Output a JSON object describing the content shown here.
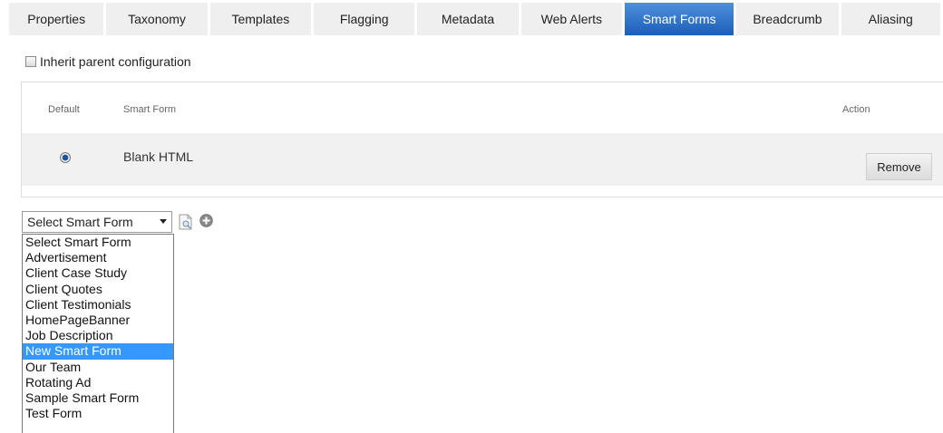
{
  "tabs": [
    {
      "label": "Properties",
      "active": false
    },
    {
      "label": "Taxonomy",
      "active": false
    },
    {
      "label": "Templates",
      "active": false
    },
    {
      "label": "Flagging",
      "active": false
    },
    {
      "label": "Metadata",
      "active": false
    },
    {
      "label": "Web Alerts",
      "active": false
    },
    {
      "label": "Smart Forms",
      "active": true
    },
    {
      "label": "Breadcrumb",
      "active": false
    },
    {
      "label": "Aliasing",
      "active": false
    }
  ],
  "inherit": {
    "label": "Inherit parent configuration",
    "checked": false
  },
  "table": {
    "headers": {
      "default": "Default",
      "smart_form": "Smart Form",
      "action": "Action"
    },
    "rows": [
      {
        "selected": true,
        "name": "Blank HTML",
        "action_label": "Remove"
      }
    ]
  },
  "select": {
    "value": "Select Smart Form",
    "options": [
      "Select Smart Form",
      "Advertisement",
      "Client Case Study",
      "Client Quotes",
      "Client Testimonials",
      "HomePageBanner",
      "Job Description",
      "New Smart Form",
      "Our Team",
      "Rotating Ad",
      "Sample Smart Form",
      "Test Form"
    ],
    "highlighted": "New Smart Form"
  },
  "icons": {
    "preview": "preview-icon",
    "add": "add-icon"
  },
  "colors": {
    "active_tab": "#2a6fc9",
    "tab_bg": "#efefef",
    "highlight": "#3399ff"
  }
}
